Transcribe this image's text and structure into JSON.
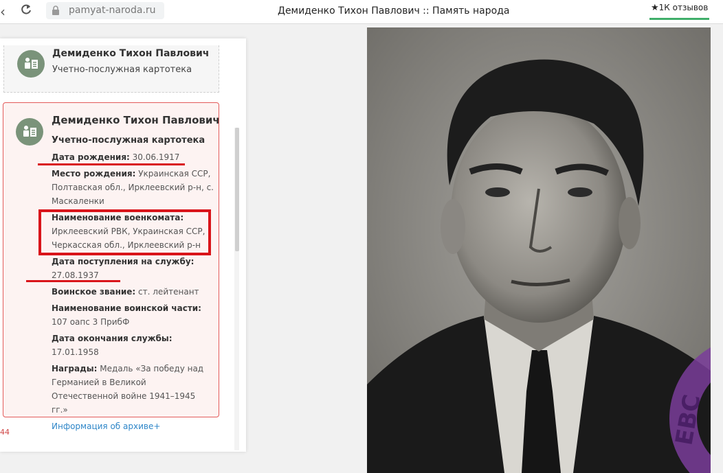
{
  "browser": {
    "url": "pamyat-naroda.ru",
    "title": "Демиденко Тихон Павлович :: Память народа",
    "reviews": "1К отзывов"
  },
  "card_top": {
    "name": "Демиденко Тихон Павлович",
    "type": "Учетно-послужная картотека"
  },
  "card_main": {
    "name": "Демиденко Тихон Павлович",
    "type": "Учетно-послужная картотека",
    "fields": [
      {
        "label": "Дата рождения:",
        "value": "30.06.1917"
      },
      {
        "label": "Место рождения:",
        "value": "Украинская ССР, Полтавская обл., Ирклеевский р-н, с. Маскаленки"
      },
      {
        "label": "Наименование военкомата:",
        "value": "Ирклеевский РВК, Украинская ССР, Черкасская обл., Ирклеевский р-н"
      },
      {
        "label": "Дата поступления на службу:",
        "value": "27.08.1937"
      },
      {
        "label": "Воинское звание:",
        "value": "ст. лейтенант"
      },
      {
        "label": "Наименование воинской части:",
        "value": "107 оапс 3 ПрибФ"
      },
      {
        "label": "Дата окончания службы:",
        "value": "17.01.1958"
      },
      {
        "label": "Награды:",
        "value": "Медаль «За победу над Германией в Великой Отечественной войне 1941–1945 гг.»"
      }
    ],
    "archive_link": "Информация об архиве+"
  },
  "page_number": "44",
  "photo": {
    "stamp_text": "ЕВС"
  },
  "colors": {
    "accent_red": "#d9141a",
    "card_border": "#e35a5a",
    "avatar_green": "#7a937a",
    "link_blue": "#2e86c8"
  }
}
